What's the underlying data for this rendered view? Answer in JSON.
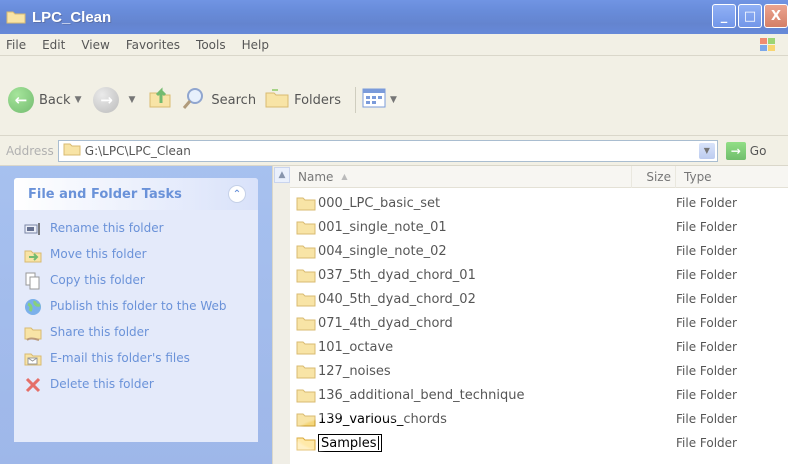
{
  "window": {
    "title": "LPC_Clean"
  },
  "menu": {
    "items": [
      "File",
      "Edit",
      "View",
      "Favorites",
      "Tools",
      "Help"
    ]
  },
  "toolbar": {
    "back_label": "Back",
    "search_label": "Search",
    "folders_label": "Folders"
  },
  "address": {
    "label": "Address",
    "value": "G:\\LPC\\LPC_Clean",
    "go_label": "Go"
  },
  "task_pane": {
    "title": "File and Folder Tasks",
    "items": [
      {
        "label": "Rename this folder",
        "icon": "rename-icon"
      },
      {
        "label": "Move this folder",
        "icon": "move-icon"
      },
      {
        "label": "Copy this folder",
        "icon": "copy-icon"
      },
      {
        "label": "Publish this folder to the Web",
        "icon": "publish-web-icon"
      },
      {
        "label": "Share this folder",
        "icon": "share-icon"
      },
      {
        "label": "E-mail this folder's files",
        "icon": "email-icon"
      },
      {
        "label": "Delete this folder",
        "icon": "delete-icon"
      }
    ]
  },
  "file_list": {
    "columns": {
      "name": "Name",
      "size": "Size",
      "type": "Type"
    },
    "rows": [
      {
        "name": "000_LPC_basic_set",
        "type": "File Folder"
      },
      {
        "name": "001_single_note_01",
        "type": "File Folder"
      },
      {
        "name": "004_single_note_02",
        "type": "File Folder"
      },
      {
        "name": "037_5th_dyad_chord_01",
        "type": "File Folder"
      },
      {
        "name": "040_5th_dyad_chord_02",
        "type": "File Folder"
      },
      {
        "name": "071_4th_dyad_chord",
        "type": "File Folder"
      },
      {
        "name": "101_octave",
        "type": "File Folder"
      },
      {
        "name": "127_noises",
        "type": "File Folder"
      },
      {
        "name": "136_additional_bend_technique",
        "type": "File Folder"
      },
      {
        "name": "139_various_chords",
        "type": "File Folder"
      }
    ],
    "renaming_row": {
      "name": "Samples",
      "type": "File Folder"
    }
  }
}
